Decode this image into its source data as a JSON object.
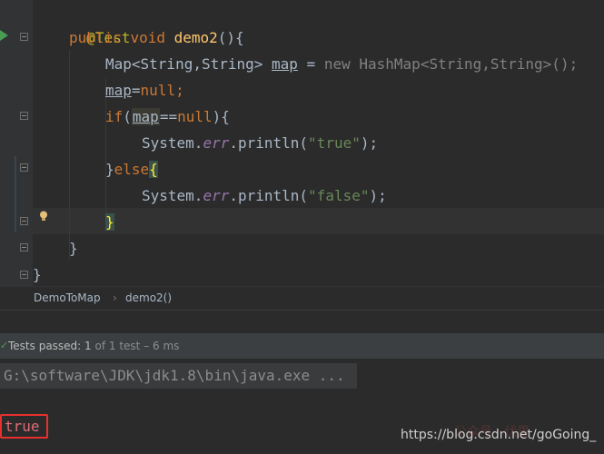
{
  "code": {
    "annotation": "@Test",
    "method_sig": {
      "public": "public",
      "void": "void",
      "name": "demo2",
      "rest": "(){"
    },
    "line3": {
      "type": "Map<String,String>",
      "var": "map",
      "eq": " = ",
      "new": "new",
      "ctor": " HashMap<String,String>();"
    },
    "line4": {
      "var": "map",
      "eq": "=",
      "null": "null",
      "semi": ";"
    },
    "line5": {
      "if": "if",
      "open": "(",
      "var": "map",
      "op": "==",
      "null": "null",
      "close": "){"
    },
    "line6": {
      "obj": "System.",
      "field": "err",
      "call": ".println(",
      "str": "\"true\"",
      "end": ");"
    },
    "line7": {
      "close": "}",
      "else": "else",
      "brace": "{"
    },
    "line8": {
      "obj": "System.",
      "field": "err",
      "call": ".println(",
      "str": "\"false\"",
      "end": ");"
    },
    "line9": "}",
    "line10": "}",
    "line11": "}"
  },
  "breadcrumb": {
    "class_name": "DemoToMap",
    "separator": "›",
    "method": "demo2()"
  },
  "test_status": {
    "check": "✓",
    "label": "Tests passed:",
    "count": "1",
    "detail": "of 1 test – 6 ms"
  },
  "console": {
    "command": "G:\\software\\JDK\\jdk1.8\\bin\\java.exe ...",
    "output": "true"
  },
  "watermark": {
    "text": "https://blog.csdn.net/goGoing_",
    "faint": "公众号 · 伏里"
  },
  "colors": {
    "run_icon": "#499c54",
    "highlight_box": "#e8312f",
    "bulb": "#e5c07b"
  }
}
